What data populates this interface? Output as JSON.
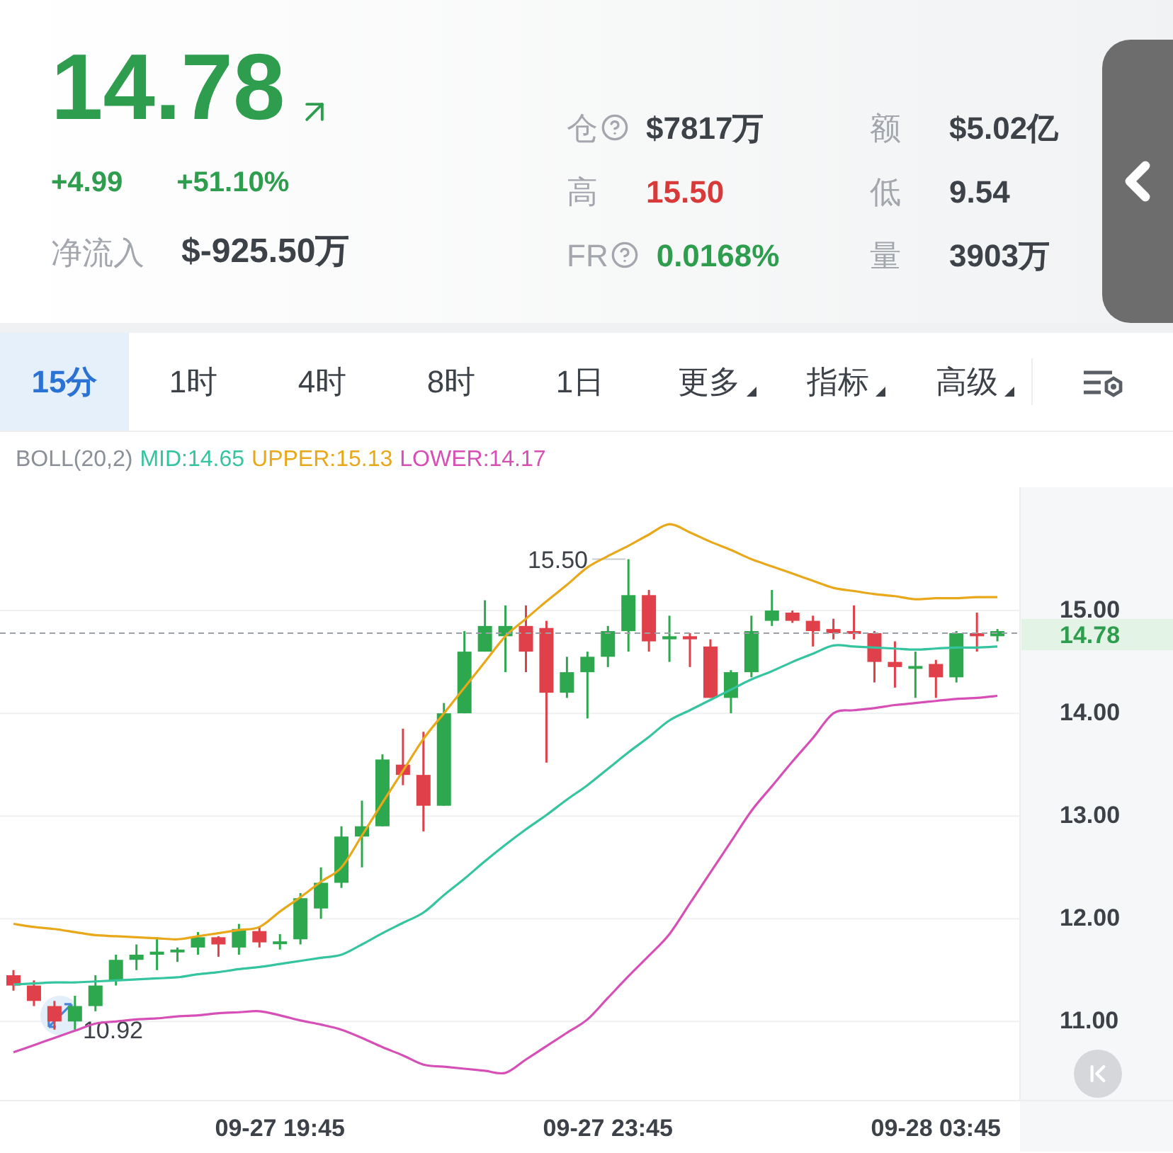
{
  "header": {
    "price": "14.78",
    "change": "+4.99",
    "change_percent": "+51.10%",
    "net_inflow": {
      "label": "净流入",
      "value": "$-925.50万"
    }
  },
  "stats": [
    {
      "label": "仓",
      "help": true,
      "value": "$7817万",
      "color": "#3d4148"
    },
    {
      "label": "额",
      "help": false,
      "value": "$5.02亿",
      "color": "#3d4148"
    },
    {
      "label": "高",
      "help": false,
      "value": "15.50",
      "color": "#d83a3a"
    },
    {
      "label": "低",
      "help": false,
      "value": "9.54",
      "color": "#3d4148"
    },
    {
      "label": "FR",
      "help": true,
      "value": "0.0168%",
      "color": "#2e9d4e"
    },
    {
      "label": "量",
      "help": false,
      "value": "3903万",
      "color": "#3d4148"
    }
  ],
  "tabs": [
    {
      "label": "15分",
      "selected": true,
      "kind": "interval"
    },
    {
      "label": "1时",
      "selected": false,
      "kind": "interval"
    },
    {
      "label": "4时",
      "selected": false,
      "kind": "interval"
    },
    {
      "label": "8时",
      "selected": false,
      "kind": "interval"
    },
    {
      "label": "1日",
      "selected": false,
      "kind": "interval"
    },
    {
      "label": "更多",
      "selected": false,
      "kind": "dropdown"
    },
    {
      "label": "指标",
      "selected": false,
      "kind": "dropdown"
    },
    {
      "label": "高级",
      "selected": false,
      "kind": "dropdown"
    }
  ],
  "indicator_legend": [
    {
      "text": "BOLL(20,2)",
      "color": "#8a8f98"
    },
    {
      "text": "MID:14.65",
      "color": "#35c4a0"
    },
    {
      "text": "UPPER:15.13",
      "color": "#e8a819"
    },
    {
      "text": "LOWER:14.17",
      "color": "#d64fb6"
    }
  ],
  "chart": {
    "chart_data": {
      "type": "candlestick",
      "grid": true,
      "ref_lines": [
        {
          "axis": "y",
          "value": 14.78,
          "label": "14.78"
        }
      ],
      "categories": [
        null,
        null,
        null,
        null,
        null,
        null,
        null,
        null,
        null,
        null,
        null,
        null,
        null,
        "09-27 19:45",
        null,
        null,
        null,
        null,
        null,
        null,
        null,
        null,
        null,
        null,
        null,
        null,
        null,
        null,
        null,
        "09-27 23:45",
        null,
        null,
        null,
        null,
        null,
        null,
        null,
        null,
        null,
        null,
        null,
        null,
        null,
        null,
        null,
        "09-28 03:45",
        null,
        null,
        null
      ],
      "ohlc": [
        [
          11.45,
          11.5,
          11.3,
          11.35
        ],
        [
          11.35,
          11.4,
          11.15,
          11.2
        ],
        [
          11.15,
          11.2,
          10.92,
          11.0
        ],
        [
          11.0,
          11.25,
          10.92,
          11.15
        ],
        [
          11.15,
          11.45,
          11.1,
          11.35
        ],
        [
          11.4,
          11.65,
          11.35,
          11.6
        ],
        [
          11.6,
          11.75,
          11.5,
          11.65
        ],
        [
          11.65,
          11.82,
          11.5,
          11.68
        ],
        [
          11.68,
          11.72,
          11.58,
          11.7
        ],
        [
          11.72,
          11.87,
          11.65,
          11.82
        ],
        [
          11.82,
          11.83,
          11.63,
          11.75
        ],
        [
          11.72,
          11.95,
          11.65,
          11.9
        ],
        [
          11.88,
          11.92,
          11.72,
          11.77
        ],
        [
          11.77,
          11.85,
          11.7,
          11.78
        ],
        [
          11.8,
          12.25,
          11.75,
          12.2
        ],
        [
          12.1,
          12.5,
          12.0,
          12.35
        ],
        [
          12.35,
          12.9,
          12.3,
          12.8
        ],
        [
          12.8,
          13.15,
          12.5,
          12.9
        ],
        [
          12.9,
          13.6,
          12.9,
          13.55
        ],
        [
          13.5,
          13.85,
          13.3,
          13.4
        ],
        [
          13.4,
          13.82,
          12.85,
          13.1
        ],
        [
          13.1,
          14.1,
          13.1,
          14.0
        ],
        [
          14.0,
          14.8,
          14.0,
          14.6
        ],
        [
          14.6,
          15.1,
          14.6,
          14.85
        ],
        [
          14.75,
          15.05,
          14.4,
          14.85
        ],
        [
          14.85,
          15.05,
          14.4,
          14.6
        ],
        [
          14.83,
          14.9,
          13.52,
          14.2
        ],
        [
          14.2,
          14.55,
          14.15,
          14.4
        ],
        [
          14.4,
          14.6,
          13.95,
          14.55
        ],
        [
          14.55,
          14.85,
          14.45,
          14.8
        ],
        [
          14.8,
          15.5,
          14.6,
          15.15
        ],
        [
          15.15,
          15.2,
          14.6,
          14.7
        ],
        [
          14.72,
          14.95,
          14.5,
          14.75
        ],
        [
          14.75,
          14.78,
          14.45,
          14.72
        ],
        [
          14.65,
          14.72,
          14.15,
          14.15
        ],
        [
          14.15,
          14.42,
          14.0,
          14.4
        ],
        [
          14.4,
          14.95,
          14.35,
          14.8
        ],
        [
          14.9,
          15.2,
          14.85,
          15.0
        ],
        [
          14.98,
          15.0,
          14.88,
          14.9
        ],
        [
          14.9,
          14.95,
          14.65,
          14.8
        ],
        [
          14.82,
          14.92,
          14.72,
          14.78
        ],
        [
          14.8,
          15.05,
          14.72,
          14.78
        ],
        [
          14.78,
          14.8,
          14.3,
          14.5
        ],
        [
          14.5,
          14.7,
          14.25,
          14.45
        ],
        [
          14.45,
          14.6,
          14.15,
          14.46
        ],
        [
          14.48,
          14.52,
          14.15,
          14.35
        ],
        [
          14.35,
          14.8,
          14.3,
          14.78
        ],
        [
          14.78,
          14.98,
          14.6,
          14.75
        ],
        [
          14.75,
          14.82,
          14.7,
          14.8
        ]
      ],
      "series": [
        {
          "type": "line",
          "color": "#e8a819",
          "values": [
            11.95,
            11.92,
            11.9,
            11.87,
            11.84,
            11.83,
            11.82,
            11.81,
            11.8,
            11.83,
            11.86,
            11.89,
            11.92,
            12.07,
            12.21,
            12.36,
            12.5,
            12.81,
            13.13,
            13.44,
            13.75,
            14.0,
            14.25,
            14.5,
            14.75,
            14.92,
            15.09,
            15.25,
            15.42,
            15.53,
            15.63,
            15.74,
            15.84,
            15.76,
            15.67,
            15.59,
            15.5,
            15.43,
            15.36,
            15.29,
            15.22,
            15.19,
            15.16,
            15.14,
            15.11,
            15.12,
            15.12,
            15.13,
            15.13
          ]
        },
        {
          "type": "line",
          "color": "#35c4a0",
          "values": [
            11.36,
            11.37,
            11.38,
            11.38,
            11.39,
            11.4,
            11.41,
            11.42,
            11.43,
            11.46,
            11.48,
            11.51,
            11.53,
            11.56,
            11.59,
            11.62,
            11.65,
            11.75,
            11.86,
            11.96,
            12.06,
            12.23,
            12.39,
            12.56,
            12.72,
            12.87,
            13.01,
            13.16,
            13.3,
            13.46,
            13.62,
            13.77,
            13.93,
            14.03,
            14.13,
            14.23,
            14.33,
            14.41,
            14.5,
            14.58,
            14.66,
            14.65,
            14.64,
            14.63,
            14.62,
            14.63,
            14.64,
            14.64,
            14.65
          ]
        },
        {
          "type": "line",
          "color": "#d64fb6",
          "values": [
            10.7,
            10.77,
            10.84,
            10.91,
            10.98,
            11.0,
            11.02,
            11.03,
            11.05,
            11.06,
            11.08,
            11.09,
            11.1,
            11.06,
            11.01,
            10.97,
            10.92,
            10.84,
            10.75,
            10.67,
            10.58,
            10.56,
            10.54,
            10.52,
            10.5,
            10.63,
            10.76,
            10.89,
            11.02,
            11.23,
            11.44,
            11.64,
            11.85,
            12.15,
            12.45,
            12.75,
            13.05,
            13.29,
            13.53,
            13.76,
            14.0,
            14.03,
            14.05,
            14.08,
            14.1,
            14.12,
            14.14,
            14.15,
            14.17
          ]
        }
      ],
      "ylim": [
        10.23,
        16.2
      ],
      "yticks": [
        {
          "value": 11,
          "label": "11.00"
        },
        {
          "value": 12,
          "label": "12.00"
        },
        {
          "value": 13,
          "label": "13.00"
        },
        {
          "value": 14,
          "label": "14.00"
        },
        {
          "value": 15,
          "label": "15.00"
        }
      ],
      "annotations": [
        "15.50",
        "10.92"
      ]
    }
  }
}
